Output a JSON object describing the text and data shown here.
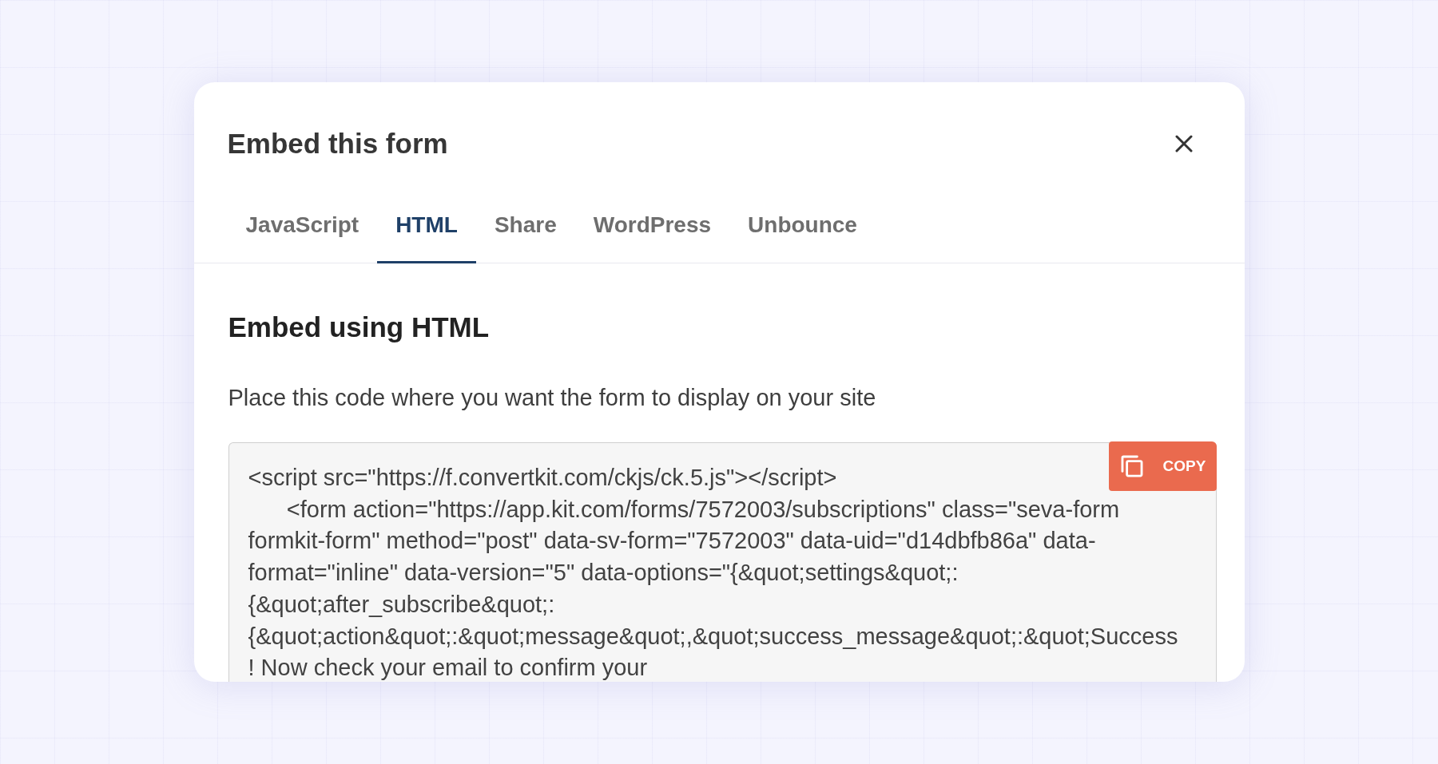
{
  "dialog": {
    "title": "Embed this form",
    "tabs": [
      {
        "label": "JavaScript",
        "selected": false
      },
      {
        "label": "HTML",
        "selected": true
      },
      {
        "label": "Share",
        "selected": false
      },
      {
        "label": "WordPress",
        "selected": false
      },
      {
        "label": "Unbounce",
        "selected": false
      }
    ],
    "section": {
      "heading": "Embed using HTML",
      "description": "Place this code where you want the form to display on your site",
      "code_lines": [
        "<script src=\"https://f.convertkit.com/ckjs/ck.5.js\"></script>",
        "      <form action=\"https://app.kit.com/forms/7572003/subscriptions\" class=\"seva-form",
        "formkit-form\" method=\"post\" data-sv-form=\"7572003\" data-uid=\"d14dbfb86a\" data-",
        "format=\"inline\" data-version=\"5\" data-options=\"{&quot;settings&quot;:",
        "{&quot;after_subscribe&quot;:",
        "{&quot;action&quot;:&quot;message&quot;,&quot;success_message&quot;:&quot;Success",
        "! Now check your email to confirm your"
      ],
      "copy_button": {
        "label": "COPY"
      }
    }
  }
}
